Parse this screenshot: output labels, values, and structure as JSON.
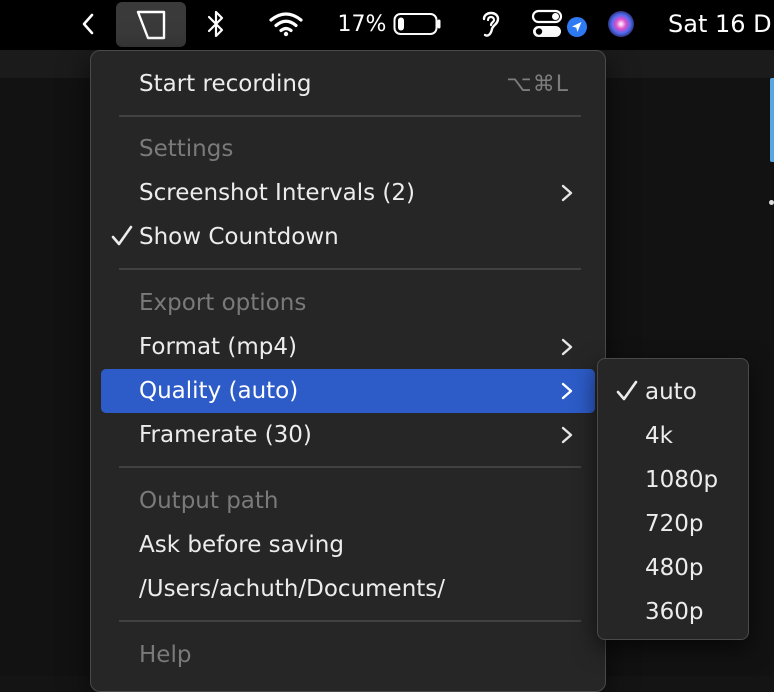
{
  "menubar": {
    "icons": [
      "chevron-left-icon",
      "app-frame-icon",
      "bluetooth-icon",
      "wifi-icon",
      "battery-icon",
      "hearing-icon",
      "control-center-icon",
      "location-icon",
      "siri-icon"
    ],
    "battery_percent": "17%",
    "battery_level": 0.17,
    "clock": "Sat 16 D"
  },
  "menu": {
    "start_recording": {
      "label": "Start recording",
      "shortcut": "⌥⌘L"
    },
    "settings_header": "Settings",
    "screenshot_intervals": "Screenshot Intervals (2)",
    "show_countdown": {
      "label": "Show Countdown",
      "checked": true
    },
    "export_header": "Export options",
    "format": "Format (mp4)",
    "quality": "Quality (auto)",
    "framerate": "Framerate (30)",
    "output_header": "Output path",
    "ask_before_saving": "Ask before saving",
    "documents_path": "/Users/achuth/Documents/",
    "help_header": "Help"
  },
  "submenu": {
    "items": [
      {
        "label": "auto",
        "checked": true
      },
      {
        "label": "4k",
        "checked": false
      },
      {
        "label": "1080p",
        "checked": false
      },
      {
        "label": "720p",
        "checked": false
      },
      {
        "label": "480p",
        "checked": false
      },
      {
        "label": "360p",
        "checked": false
      }
    ]
  },
  "colors": {
    "highlight": "#2d5cc8",
    "menu_bg": "#262626",
    "menubar_bg": "#000000",
    "header_text": "#7a7a7a",
    "item_text": "#ececec"
  }
}
